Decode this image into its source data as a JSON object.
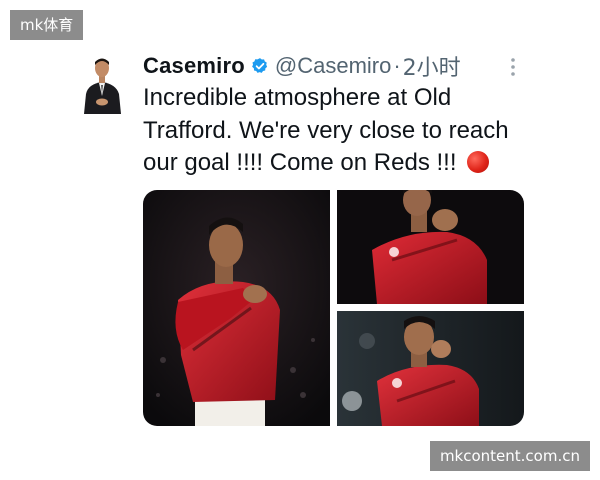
{
  "watermarks": {
    "top": "mk体育",
    "bottom": "mkcontent.com.cn"
  },
  "tweet": {
    "author_name": "Casemiro",
    "handle": "@Casemiro",
    "separator": "·",
    "time": "2小时",
    "verified_icon": "verified-badge-icon",
    "more_icon": "more-vertical-icon",
    "text_lines": [
      "Incredible atmosphere at Old",
      "Trafford. We're very close to reach",
      "our goal !!!! Come on Reds !!!"
    ],
    "emoji": "red-circle-icon",
    "colors": {
      "verified": "#1d9bf0",
      "secondary_text": "#536471",
      "jersey_red": "#c8102e",
      "emoji_red": "#e0251a"
    }
  }
}
